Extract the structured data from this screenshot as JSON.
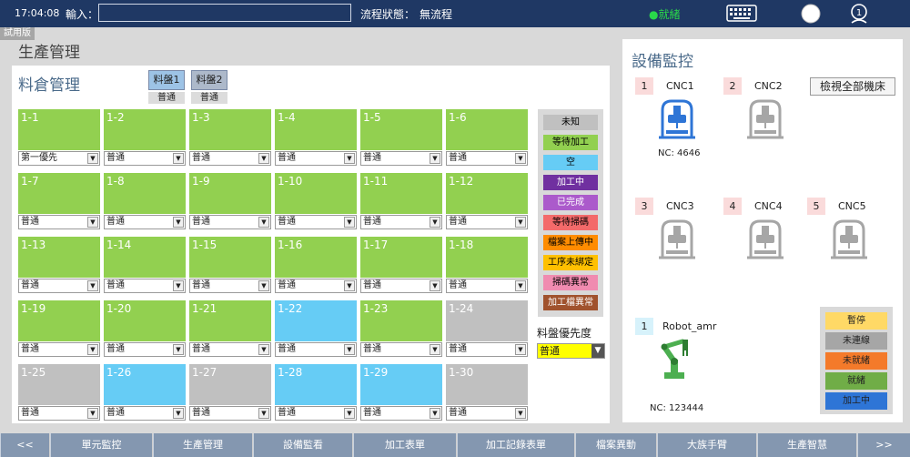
{
  "header": {
    "time": "17:04:08",
    "input_label": "輸入：",
    "input_value": "",
    "flow_label": "流程狀態：",
    "flow_value": "無流程",
    "ready_status": "●就緒",
    "icons": [
      "keyboard-icon",
      "circle-icon",
      "user-icon"
    ]
  },
  "trial_badge": "試用版",
  "page_title": "生產管理",
  "warehouse": {
    "title": "料倉管理",
    "tray_tabs": [
      {
        "label": "料盤1",
        "sub": "普通"
      },
      {
        "label": "料盤2",
        "sub": "普通"
      }
    ],
    "slots": [
      {
        "id": "1-1",
        "status": "waiting",
        "priority": "第一優先"
      },
      {
        "id": "1-2",
        "status": "waiting",
        "priority": "普通"
      },
      {
        "id": "1-3",
        "status": "waiting",
        "priority": "普通"
      },
      {
        "id": "1-4",
        "status": "waiting",
        "priority": "普通"
      },
      {
        "id": "1-5",
        "status": "waiting",
        "priority": "普通"
      },
      {
        "id": "1-6",
        "status": "waiting",
        "priority": "普通"
      },
      {
        "id": "1-7",
        "status": "waiting",
        "priority": "普通"
      },
      {
        "id": "1-8",
        "status": "waiting",
        "priority": "普通"
      },
      {
        "id": "1-9",
        "status": "waiting",
        "priority": "普通"
      },
      {
        "id": "1-10",
        "status": "waiting",
        "priority": "普通"
      },
      {
        "id": "1-11",
        "status": "waiting",
        "priority": "普通"
      },
      {
        "id": "1-12",
        "status": "waiting",
        "priority": "普通"
      },
      {
        "id": "1-13",
        "status": "waiting",
        "priority": "普通"
      },
      {
        "id": "1-14",
        "status": "waiting",
        "priority": "普通"
      },
      {
        "id": "1-15",
        "status": "waiting",
        "priority": "普通"
      },
      {
        "id": "1-16",
        "status": "waiting",
        "priority": "普通"
      },
      {
        "id": "1-17",
        "status": "waiting",
        "priority": "普通"
      },
      {
        "id": "1-18",
        "status": "waiting",
        "priority": "普通"
      },
      {
        "id": "1-19",
        "status": "waiting",
        "priority": "普通"
      },
      {
        "id": "1-20",
        "status": "waiting",
        "priority": "普通"
      },
      {
        "id": "1-21",
        "status": "waiting",
        "priority": "普通"
      },
      {
        "id": "1-22",
        "status": "empty",
        "priority": "普通"
      },
      {
        "id": "1-23",
        "status": "waiting",
        "priority": "普通"
      },
      {
        "id": "1-24",
        "status": "unknown",
        "priority": "普通"
      },
      {
        "id": "1-25",
        "status": "unknown",
        "priority": "普通"
      },
      {
        "id": "1-26",
        "status": "empty",
        "priority": "普通"
      },
      {
        "id": "1-27",
        "status": "unknown",
        "priority": "普通"
      },
      {
        "id": "1-28",
        "status": "empty",
        "priority": "普通"
      },
      {
        "id": "1-29",
        "status": "empty",
        "priority": "普通"
      },
      {
        "id": "1-30",
        "status": "unknown",
        "priority": "普通"
      }
    ],
    "status_colors": {
      "waiting": "#92d050",
      "empty": "#66ccf5",
      "unknown": "#c0c0c0"
    },
    "legend": [
      {
        "label": "未知",
        "color": "#c0c0c0",
        "text": "#000000"
      },
      {
        "label": "等待加工",
        "color": "#92d050",
        "text": "#000000"
      },
      {
        "label": "空",
        "color": "#66ccf5",
        "text": "#000000"
      },
      {
        "label": "加工中",
        "color": "#7030a0",
        "text": "#ffffff"
      },
      {
        "label": "已完成",
        "color": "#ab5acb",
        "text": "#ffffff"
      },
      {
        "label": "等待掃碼",
        "color": "#f36a6a",
        "text": "#000000"
      },
      {
        "label": "檔案上傳中",
        "color": "#ff8c00",
        "text": "#000000"
      },
      {
        "label": "工序未綁定",
        "color": "#ffc000",
        "text": "#000000"
      },
      {
        "label": "掃碼異常",
        "color": "#f08bb0",
        "text": "#000000"
      },
      {
        "label": "加工檔異常",
        "color": "#a0522d",
        "text": "#ffffff"
      }
    ],
    "tray_priority_label": "料盤優先度",
    "tray_priority_value": "普通"
  },
  "equipment": {
    "title": "設備監控",
    "view_all": "檢視全部機床",
    "machines": [
      {
        "num": "1",
        "name": "CNC1",
        "active": true,
        "nc": "NC: 4646"
      },
      {
        "num": "2",
        "name": "CNC2",
        "active": false,
        "nc": ""
      },
      {
        "num": "3",
        "name": "CNC3",
        "active": false,
        "nc": ""
      },
      {
        "num": "4",
        "name": "CNC4",
        "active": false,
        "nc": ""
      },
      {
        "num": "5",
        "name": "CNC5",
        "active": false,
        "nc": ""
      }
    ],
    "robot": {
      "num": "1",
      "name": "Robot_amr",
      "nc": "NC: 123444"
    },
    "robot_legend": [
      {
        "label": "暫停",
        "color": "#ffd966"
      },
      {
        "label": "未連線",
        "color": "#a6a6a6"
      },
      {
        "label": "未就緒",
        "color": "#f47a2a"
      },
      {
        "label": "就緒",
        "color": "#70ad47"
      },
      {
        "label": "加工中",
        "color": "#2e75d6"
      }
    ]
  },
  "bottom_nav": [
    "<<",
    "單元監控",
    "生產管理",
    "設備監看",
    "加工表單",
    "加工記錄表單",
    "檔案異動",
    "大族手臂",
    "生產智慧",
    ">>"
  ]
}
